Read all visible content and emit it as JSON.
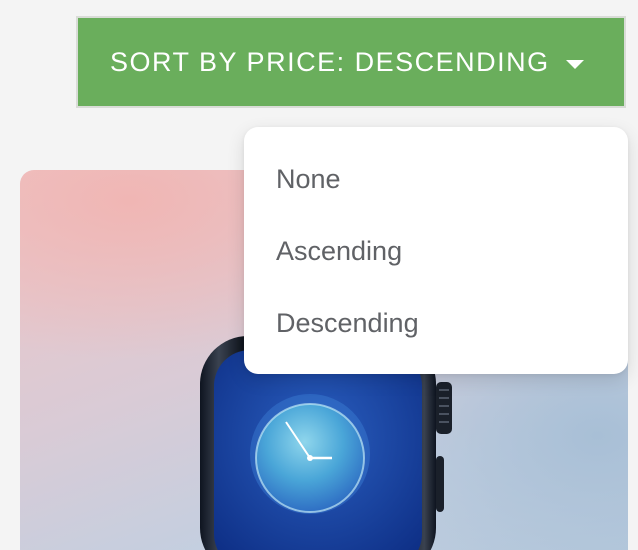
{
  "sort": {
    "label": "SORT BY PRICE: DESCENDING",
    "icon": "caret-down-icon",
    "color": "#6aae5c"
  },
  "dropdown": {
    "options": [
      {
        "label": "None"
      },
      {
        "label": "Ascending"
      },
      {
        "label": "Descending"
      }
    ],
    "selected": "Descending"
  },
  "product": {
    "image": "smartwatch-image"
  }
}
